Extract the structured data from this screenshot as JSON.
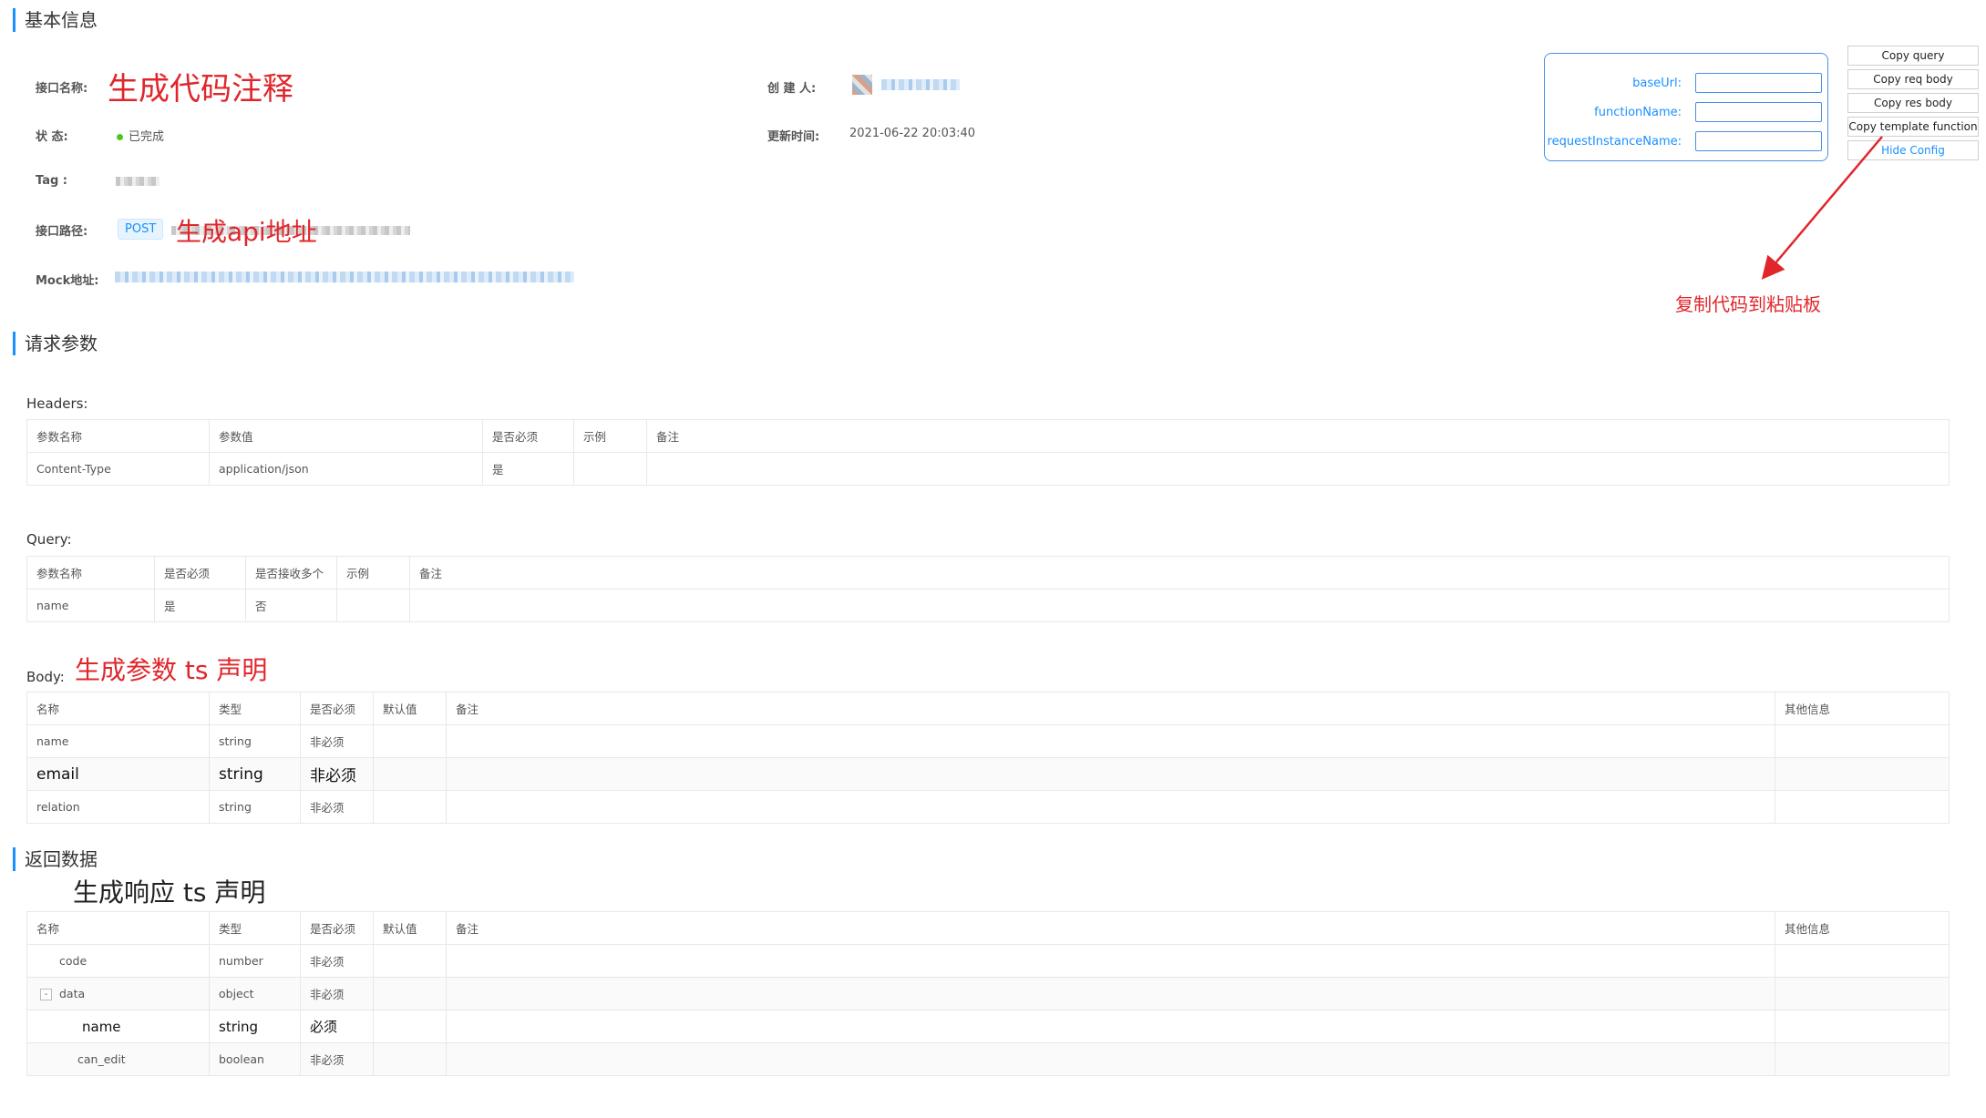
{
  "sections": {
    "basic": "基本信息",
    "request": "请求参数",
    "response": "返回数据"
  },
  "basic_info": {
    "name_label": "接口名称:",
    "status_label": "状 态:",
    "status_value": "已完成",
    "tag_label": "Tag :",
    "path_label": "接口路径:",
    "method": "POST",
    "mock_label": "Mock地址:",
    "creator_label": "创 建 人:",
    "updated_label": "更新时间:",
    "updated_value": "2021-06-22 20:03:40"
  },
  "annotations": {
    "name_note": "生成代码注释",
    "api_note": "生成api地址",
    "clipboard_note": "复制代码到粘贴板",
    "body_note": "生成参数 ts 声明",
    "response_note": "生成响应 ts 声明"
  },
  "config": {
    "base_url_label": "baseUrl:",
    "function_name_label": "functionName:",
    "request_instance_label": "requestInstanceName:"
  },
  "buttons": {
    "copy_query": "Copy query",
    "copy_req_body": "Copy req body",
    "copy_res_body": "Copy res body",
    "copy_template": "Copy template function",
    "hide_config": "Hide Config"
  },
  "headers": {
    "title": "Headers:",
    "columns": [
      "参数名称",
      "参数值",
      "是否必须",
      "示例",
      "备注"
    ],
    "rows": [
      [
        "Content-Type",
        "application/json",
        "是",
        "",
        ""
      ]
    ]
  },
  "query": {
    "title": "Query:",
    "columns": [
      "参数名称",
      "是否必须",
      "是否接收多个",
      "示例",
      "备注"
    ],
    "rows": [
      [
        "name",
        "是",
        "否",
        "",
        ""
      ]
    ]
  },
  "body": {
    "title": "Body:",
    "columns": [
      "名称",
      "类型",
      "是否必须",
      "默认值",
      "备注",
      "其他信息"
    ],
    "rows": [
      [
        "name",
        "string",
        "非必须",
        "",
        "",
        ""
      ],
      [
        "email",
        "string",
        "非必须",
        "",
        "",
        ""
      ],
      [
        "relation",
        "string",
        "非必须",
        "",
        "",
        ""
      ]
    ]
  },
  "response": {
    "columns": [
      "名称",
      "类型",
      "是否必须",
      "默认值",
      "备注",
      "其他信息"
    ],
    "rows": [
      [
        "code",
        "number",
        "非必须",
        "",
        "",
        ""
      ],
      [
        "data",
        "object",
        "非必须",
        "",
        "",
        ""
      ],
      [
        "name",
        "string",
        "必须",
        "",
        "",
        ""
      ],
      [
        "can_edit",
        "boolean",
        "非必须",
        "",
        "",
        ""
      ]
    ],
    "expand_symbol": "-"
  }
}
